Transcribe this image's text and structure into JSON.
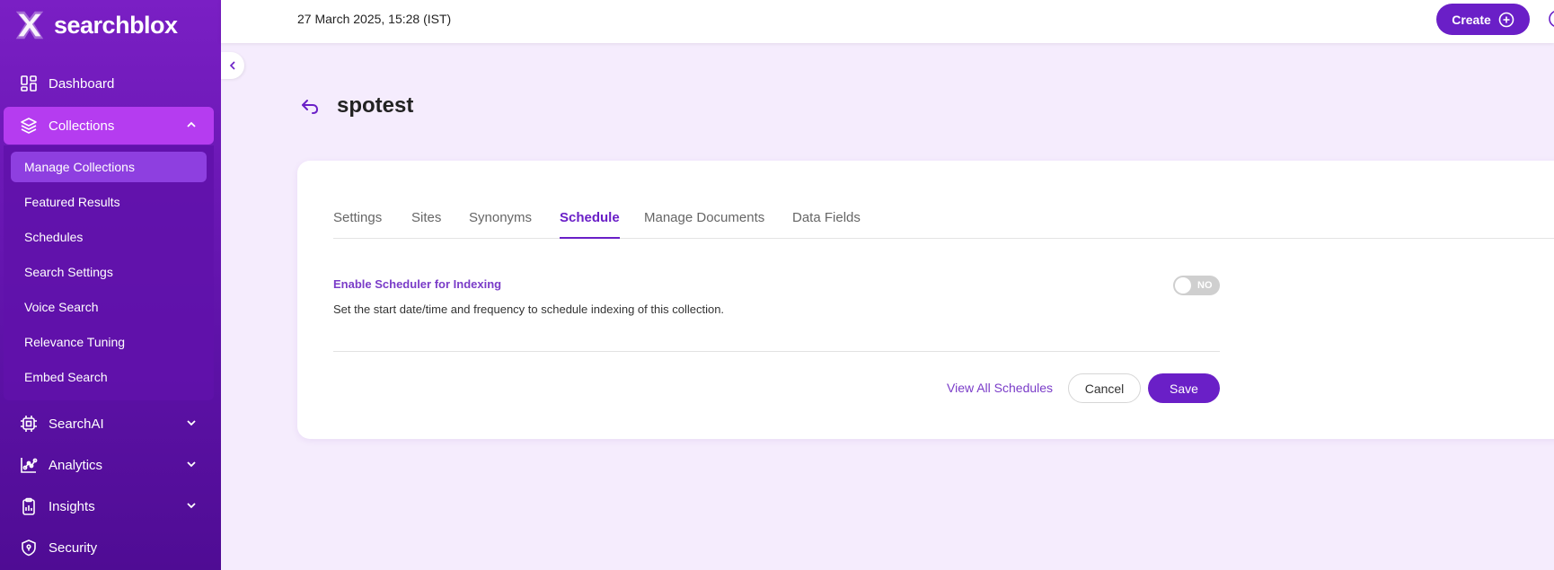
{
  "brand": {
    "name": "searchblox"
  },
  "header": {
    "datetime": "27 March 2025, 15:28 (IST)",
    "create_label": "Create"
  },
  "sidebar": {
    "items": [
      {
        "label": "Dashboard",
        "icon": "dashboard-icon"
      },
      {
        "label": "Collections",
        "icon": "layers-icon",
        "expanded": true
      },
      {
        "label": "SearchAI",
        "icon": "chip-icon"
      },
      {
        "label": "Analytics",
        "icon": "analytics-icon"
      },
      {
        "label": "Insights",
        "icon": "clipboard-icon"
      },
      {
        "label": "Security",
        "icon": "shield-icon"
      }
    ],
    "collections_sub": [
      "Manage Collections",
      "Featured Results",
      "Schedules",
      "Search Settings",
      "Voice Search",
      "Relevance Tuning",
      "Embed Search"
    ]
  },
  "page": {
    "title": "spotest"
  },
  "tabs": [
    "Settings",
    "Sites",
    "Synonyms",
    "Schedule",
    "Manage Documents",
    "Data Fields"
  ],
  "active_tab": "Schedule",
  "schedule": {
    "label": "Enable Scheduler for Indexing",
    "description": "Set the start date/time and frequency to schedule indexing of this collection.",
    "toggle_text": "NO",
    "enabled": false
  },
  "actions": {
    "view_all": "View All Schedules",
    "cancel": "Cancel",
    "save": "Save"
  },
  "colors": {
    "accent": "#6a1fc7",
    "sidebar": "#6a17b8",
    "sidebar_active": "#b53cf0",
    "background": "#f5ecfd"
  }
}
